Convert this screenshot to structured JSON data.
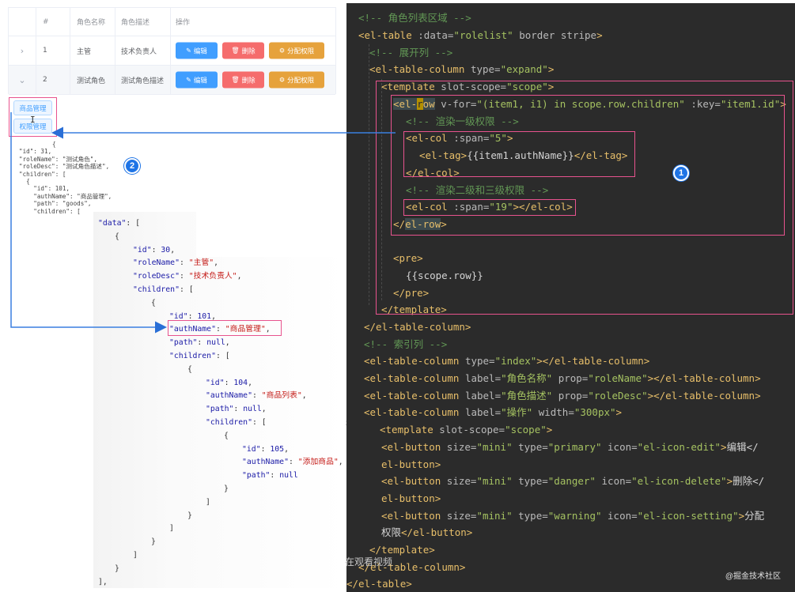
{
  "table": {
    "headers": [
      "#",
      "角色名称",
      "角色描述",
      "操作"
    ],
    "rows": [
      {
        "expand": "›",
        "index": "1",
        "name": "主管",
        "desc": "技术负责人"
      },
      {
        "expand": "⌄",
        "index": "2",
        "name": "测试角色",
        "desc": "测试角色描述"
      }
    ],
    "buttons": {
      "edit": "编辑",
      "delete": "删除",
      "assign": "分配权限"
    }
  },
  "tags": [
    "商品管理",
    "权限管理"
  ],
  "cursor_text": "I",
  "pre_small": [
    "{",
    "\"id\": 31,",
    "\"roleName\": \"测试角色\",",
    "\"roleDesc\": \"测试角色描述\",",
    "\"children\": [",
    "  {",
    "    \"id\": 101,",
    "    \"authName\": \"商品管理\",",
    "    \"path\": \"goods\",",
    "    \"children\": [",
    "      "
  ],
  "badges": {
    "one": "1",
    "two": "2"
  },
  "json": {
    "data_key": "\"data\"",
    "id30": "30",
    "roleName": "\"主管\"",
    "roleDesc": "\"技术负责人\"",
    "id101": "101",
    "authName101": "\"商品管理\"",
    "path101": "null",
    "id104": "104",
    "authName104": "\"商品列表\"",
    "path104": "null",
    "id105": "105",
    "authName105": "\"添加商品\"",
    "path105": "null"
  },
  "watermark": "在观看视频",
  "footer": "@掘金技术社区",
  "code": {
    "c1": "<!-- 角色列表区域 -->",
    "c2": "<!-- 展开列 -->",
    "c3": "<!-- 渲染一级权限 -->",
    "c4": "<!-- 渲染二级和三级权限 -->",
    "c5": "<!-- 索引列 -->",
    "attr_span5": "\"5\"",
    "attr_span19": "\"19\"",
    "label_name": "\"角色名称\"",
    "label_desc": "\"角色描述\"",
    "label_ops": "\"操作\"",
    "text_edit": "编辑</",
    "text_del": "删除</",
    "text_assign1": "分配",
    "text_assign2": "权限"
  }
}
